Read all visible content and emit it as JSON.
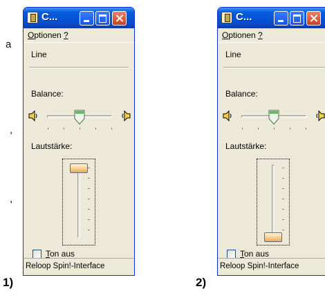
{
  "margin_text": [
    "a",
    ",",
    ","
  ],
  "windows": [
    {
      "number": "1)",
      "title": "C...",
      "menu": {
        "optionen": "ptionen",
        "optionen_mnemonic": "O",
        "help": "?"
      },
      "line_label": "Line",
      "balance_label": "Balance:",
      "balance_value": 0.5,
      "volume_label": "Lautstärke:",
      "volume_level": 1.0,
      "mute_label_mnemonic": "T",
      "mute_label_rest": "on aus",
      "mute_checked": false,
      "status": "Reloop Spin!-Interface"
    },
    {
      "number": "2)",
      "title": "C...",
      "menu": {
        "optionen": "ptionen",
        "optionen_mnemonic": "O",
        "help": "?"
      },
      "line_label": "Line",
      "balance_label": "Balance:",
      "balance_value": 0.5,
      "volume_label": "Lautstärke:",
      "volume_level": 0.0,
      "mute_label_mnemonic": "T",
      "mute_label_rest": "on aus",
      "mute_checked": false,
      "status": "Reloop Spin!-Interface"
    }
  ],
  "colors": {
    "titlebar": "#0a5bdc",
    "window_face": "#ece9d8",
    "close_button": "#c8401e",
    "slider_thumb_orange": "#e3a85c",
    "balance_thumb_green": "#5fbf5f"
  }
}
